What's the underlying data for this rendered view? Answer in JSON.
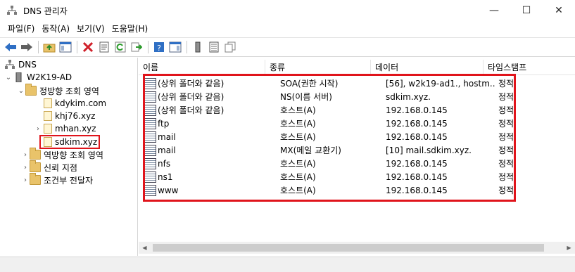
{
  "window": {
    "title": "DNS 관리자",
    "minimize": "—",
    "maximize": "☐",
    "close": "✕"
  },
  "menu": [
    "파일(F)",
    "동작(A)",
    "보기(V)",
    "도움말(H)"
  ],
  "tree": {
    "root": "DNS",
    "server": "W2K19-AD",
    "forward": "정방향 조회 영역",
    "zones": [
      "kdykim.com",
      "khj76.xyz",
      "mhan.xyz",
      "sdkim.xyz"
    ],
    "reverse": "역방향 조회 영역",
    "trust": "신뢰 지점",
    "conditional": "조건부 전달자"
  },
  "columns": [
    "이름",
    "종류",
    "데이터",
    "타임스탬프"
  ],
  "records": [
    {
      "name": "(상위 폴더와 같음)",
      "type": "SOA(권한 시작)",
      "data": "[56], w2k19-ad1., hostm...",
      "ts": "정적"
    },
    {
      "name": "(상위 폴더와 같음)",
      "type": "NS(이름 서버)",
      "data": "sdkim.xyz.",
      "ts": "정적"
    },
    {
      "name": "(상위 폴더와 같음)",
      "type": "호스트(A)",
      "data": "192.168.0.145",
      "ts": "정적"
    },
    {
      "name": "ftp",
      "type": "호스트(A)",
      "data": "192.168.0.145",
      "ts": "정적"
    },
    {
      "name": "mail",
      "type": "호스트(A)",
      "data": "192.168.0.145",
      "ts": "정적"
    },
    {
      "name": "mail",
      "type": "MX(메일 교환기)",
      "data": "[10]  mail.sdkim.xyz.",
      "ts": "정적"
    },
    {
      "name": "nfs",
      "type": "호스트(A)",
      "data": "192.168.0.145",
      "ts": "정적"
    },
    {
      "name": "ns1",
      "type": "호스트(A)",
      "data": "192.168.0.145",
      "ts": "정적"
    },
    {
      "name": "www",
      "type": "호스트(A)",
      "data": "192.168.0.145",
      "ts": "정적"
    }
  ],
  "colors": {
    "highlight": "#e0141b",
    "folder": "#e9c36a",
    "tb_blue": "#2f6fc4",
    "tb_red": "#d0202a"
  }
}
